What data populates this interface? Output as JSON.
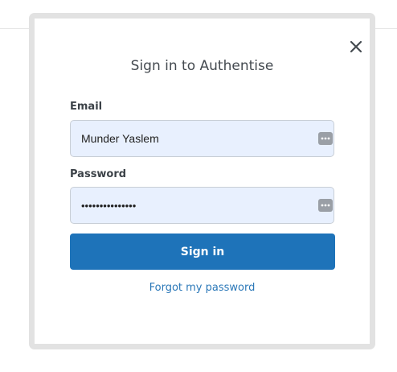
{
  "dialog": {
    "title": "Sign in to Authentise",
    "close_icon": "close-icon"
  },
  "email": {
    "label": "Email",
    "value": "Munder Yaslem",
    "autofill_icon": "autofill-icon"
  },
  "password": {
    "label": "Password",
    "value": "•••••••••••••••",
    "autofill_icon": "autofill-icon"
  },
  "actions": {
    "signin_label": "Sign in",
    "forgot_label": "Forgot my password"
  },
  "colors": {
    "primary_button": "#1e73b9",
    "link": "#2b78b8",
    "input_background": "#e8f0fe",
    "frame_border": "#e2e2e2"
  }
}
